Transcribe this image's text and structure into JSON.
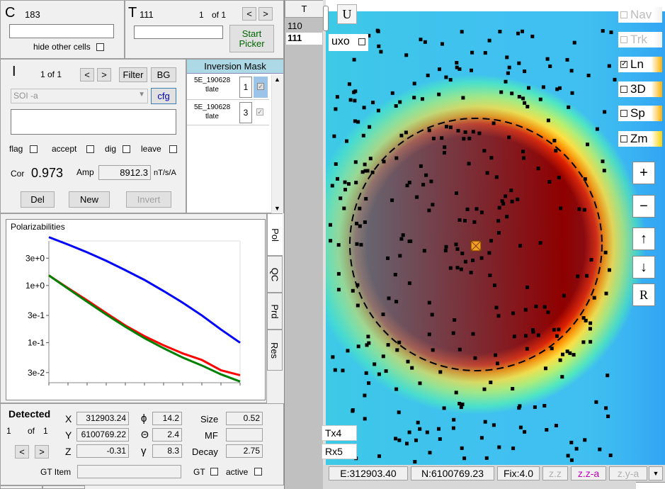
{
  "cell": {
    "label": "C",
    "count": "183",
    "hide_label": "hide other cells"
  },
  "target": {
    "label": "T",
    "count": "111",
    "index": "1",
    "of": "of 1",
    "prev": "<",
    "next": ">",
    "start_picker": "Start Picker"
  },
  "item": {
    "label": "I",
    "pos": "1 of 1",
    "prev": "<",
    "next": ">",
    "filter": "Filter",
    "bg": "BG",
    "model": "SOI -a",
    "cfg": "cfg",
    "flags": [
      "flag",
      "accept",
      "dig",
      "leave"
    ],
    "cor_label": "Cor",
    "cor": "0.973",
    "amp_label": "Amp",
    "amp": "8912.3",
    "amp_unit": "nT/s/A",
    "del": "Del",
    "new": "New",
    "invert": "Invert"
  },
  "mask": {
    "title": "Inversion Mask",
    "rows": [
      {
        "name": "5E_190628",
        "sub": "tlate",
        "n": "1"
      },
      {
        "name": "5E_190628",
        "sub": "tlate",
        "n": "3"
      }
    ]
  },
  "t_list": {
    "header": "T",
    "items": [
      "110",
      "111"
    ]
  },
  "tabs": [
    "Pol",
    "QC",
    "Prd",
    "Res"
  ],
  "chart_data": {
    "type": "line",
    "title": "Polarizabilities",
    "yscale": "log",
    "ylim": [
      0.02,
      6
    ],
    "yticks": [
      "3e+0",
      "1e+0",
      "3e-1",
      "1e-1",
      "3e-2"
    ],
    "ytick_values": [
      3,
      1,
      0.3,
      0.1,
      0.03
    ],
    "x": [
      0,
      1,
      2,
      3,
      4,
      5,
      6,
      7,
      8,
      9,
      10
    ],
    "series": [
      {
        "color": "#0000ff",
        "values": [
          7.0,
          5.2,
          3.8,
          2.7,
          1.85,
          1.25,
          0.8,
          0.5,
          0.3,
          0.17,
          0.1
        ]
      },
      {
        "color": "#ff0000",
        "values": [
          1.5,
          0.9,
          0.55,
          0.33,
          0.2,
          0.13,
          0.09,
          0.065,
          0.05,
          0.033,
          0.027
        ]
      },
      {
        "color": "#008000",
        "values": [
          1.5,
          0.88,
          0.52,
          0.31,
          0.19,
          0.12,
          0.08,
          0.055,
          0.04,
          0.028,
          0.021
        ]
      }
    ]
  },
  "detected": {
    "title": "Detected",
    "index": "1",
    "of": "of",
    "total": "1",
    "prev": "<",
    "next": ">",
    "x_label": "X",
    "x": "312903.24",
    "y_label": "Y",
    "y": "6100769.22",
    "z_label": "Z",
    "z": "-0.31",
    "phi_label": "ϕ",
    "phi": "14.2",
    "theta_label": "Θ",
    "theta": "2.4",
    "gamma_label": "γ",
    "gamma": "8.3",
    "size_label": "Size",
    "size": "0.52",
    "mf_label": "MF",
    "mf": "",
    "decay_label": "Decay",
    "decay": "2.75",
    "gt_item_label": "GT Item",
    "gt_label": "GT",
    "active_label": "active"
  },
  "map": {
    "u": "U",
    "uxo": "uxo",
    "layers": [
      {
        "name": "Nav",
        "checked": false,
        "enabled": false,
        "color": "#bbbbbb"
      },
      {
        "name": "Trk",
        "checked": false,
        "enabled": false,
        "color": "#bbbbbb"
      },
      {
        "name": "Ln",
        "checked": true,
        "enabled": true,
        "color": "#000000"
      },
      {
        "name": "3D",
        "checked": false,
        "enabled": true,
        "color": "#000000"
      },
      {
        "name": "Sp",
        "checked": false,
        "enabled": true,
        "color": "#000000"
      },
      {
        "name": "Zm",
        "checked": false,
        "enabled": true,
        "color": "#000000"
      }
    ],
    "zoom_in": "+",
    "zoom_out": "−",
    "up": "↑",
    "down": "↓",
    "reset": "R",
    "tx": "Tx4",
    "rx": "Rx5"
  },
  "status": {
    "e": "E:312903.40",
    "n": "N:6100769.23",
    "fix": "Fix:4.0",
    "zz": "z.z",
    "zza": "z.z-a",
    "zya": "z.y-a"
  }
}
